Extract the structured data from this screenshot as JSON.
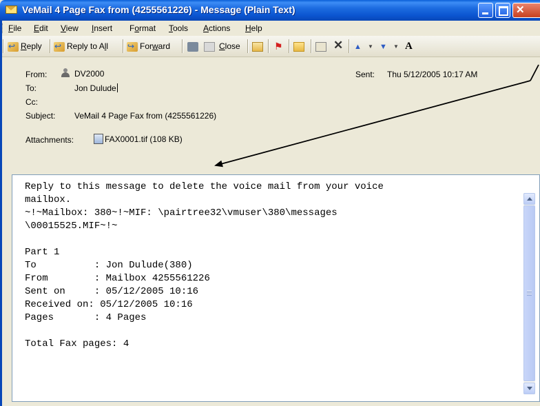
{
  "window": {
    "title": "VeMail 4 Page Fax from (4255561226) - Message (Plain Text)"
  },
  "menu": [
    {
      "pre": "",
      "ul": "F",
      "post": "ile"
    },
    {
      "pre": "",
      "ul": "E",
      "post": "dit"
    },
    {
      "pre": "",
      "ul": "V",
      "post": "iew"
    },
    {
      "pre": "",
      "ul": "I",
      "post": "nsert"
    },
    {
      "pre": "F",
      "ul": "o",
      "post": "rmat"
    },
    {
      "pre": "",
      "ul": "T",
      "post": "ools"
    },
    {
      "pre": "",
      "ul": "A",
      "post": "ctions"
    },
    {
      "pre": "",
      "ul": "H",
      "post": "elp"
    }
  ],
  "toolbar": {
    "reply": {
      "pre": "",
      "ul": "R",
      "post": "eply"
    },
    "reply_all": {
      "pre": "Reply to A",
      "ul": "l",
      "post": "l"
    },
    "forward": {
      "pre": "For",
      "ul": "w",
      "post": "ard"
    },
    "close": {
      "pre": "",
      "ul": "C",
      "post": "lose"
    },
    "font_size_glyph": "A"
  },
  "header": {
    "from_label": "From:",
    "from_value": "DV2000",
    "sent_label": "Sent:",
    "sent_value": "Thu 5/12/2005 10:17 AM",
    "to_label": "To:",
    "to_value": "Jon Dulude",
    "cc_label": "Cc:",
    "cc_value": "",
    "subject_label": "Subject:",
    "subject_value": "VeMail 4 Page Fax from (4255561226)",
    "attachments_label": "Attachments:",
    "attachment_name": "FAX0001.tif (108 KB)"
  },
  "body": {
    "lines": [
      "Reply to this message to delete the voice mail from your voice",
      "mailbox.",
      "~!~Mailbox: 380~!~MIF: \\pairtree32\\vmuser\\380\\messages",
      "\\00015525.MIF~!~",
      "",
      "Part 1",
      "To          : Jon Dulude(380)",
      "From        : Mailbox 4255561226",
      "Sent on     : 05/12/2005 10:16",
      "Received on: 05/12/2005 10:16",
      "Pages       : 4 Pages",
      "",
      "Total Fax pages: 4"
    ]
  },
  "colors": {
    "titlebar": "#0b55d0",
    "chrome": "#ece9d8",
    "annotation_arrow": "#000000"
  }
}
